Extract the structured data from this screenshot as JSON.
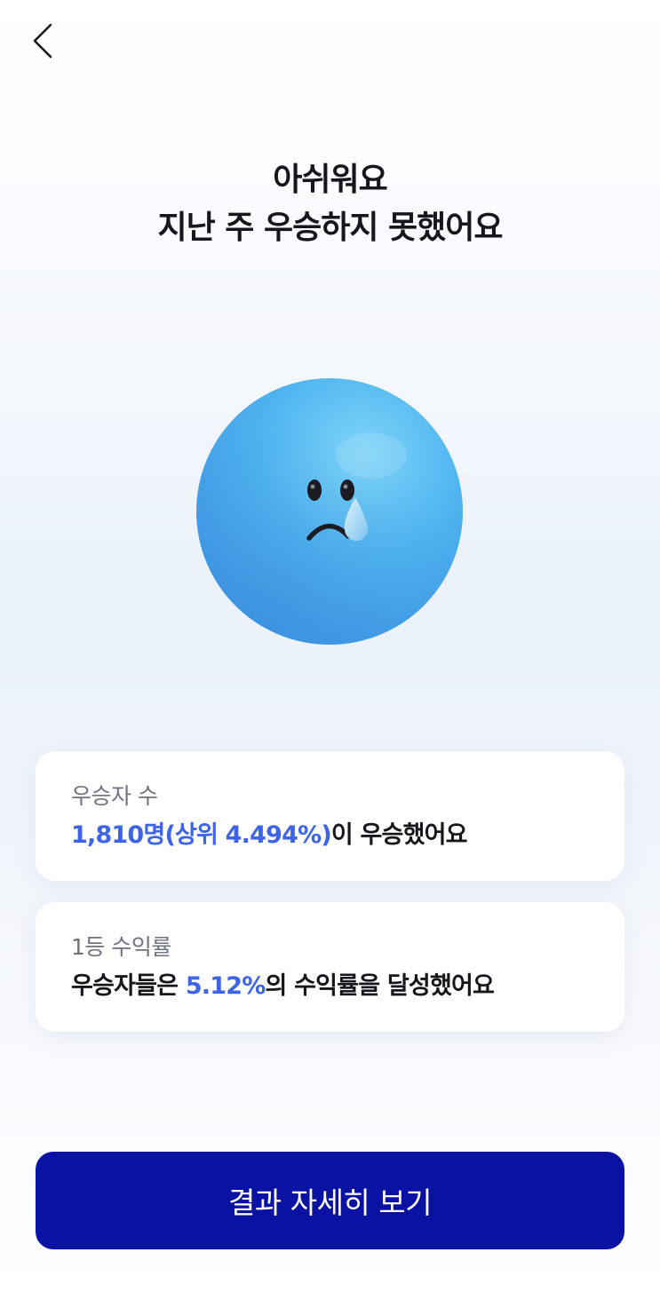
{
  "header": {
    "back_icon": "chevron-left-icon"
  },
  "title": {
    "line1": "아쉬워요",
    "line2": "지난 주 우승하지 못했어요"
  },
  "mascot": {
    "icon": "crying-face-ball",
    "color": "#4fb4f0"
  },
  "cards": [
    {
      "label": "우승자 수",
      "highlight": "1,810명(상위 4.494%)",
      "rest": "이 우승했어요"
    },
    {
      "label": "1등 수익률",
      "prefix": "우승자들은 ",
      "highlight": "5.12%",
      "suffix": "의 수익률을 달성했어요"
    }
  ],
  "cta": {
    "label": "결과 자세히 보기"
  },
  "colors": {
    "accent": "#3d63e8",
    "button": "#0a12a4",
    "text": "#15171c",
    "muted": "#6d7380"
  }
}
